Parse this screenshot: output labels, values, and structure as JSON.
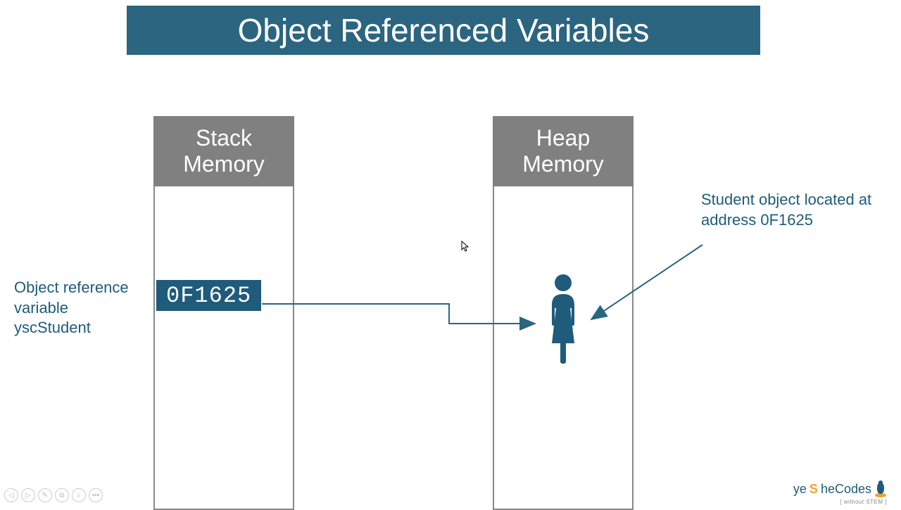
{
  "colors": {
    "banner_bg": "#2b6580",
    "header_bg": "#808080",
    "chip_bg": "#1f5b7a",
    "text_dark": "#1f5b7a",
    "arrow": "#2b6580"
  },
  "title": "Object Referenced Variables",
  "stack": {
    "header": "Stack Memory",
    "address_value": "0F1625"
  },
  "heap": {
    "header": "Heap Memory"
  },
  "left_label": "Object reference variable yscStudent",
  "right_label": "Student object located at address 0F1625",
  "logo": {
    "pre": "ye",
    "s": "S",
    "post": "heCodes",
    "sub": "[ without STEM ]"
  },
  "controls": {
    "back": "◁",
    "play": "▷",
    "pen": "✎",
    "screen": "⧉",
    "zoom": "⌕",
    "more": "•••"
  }
}
